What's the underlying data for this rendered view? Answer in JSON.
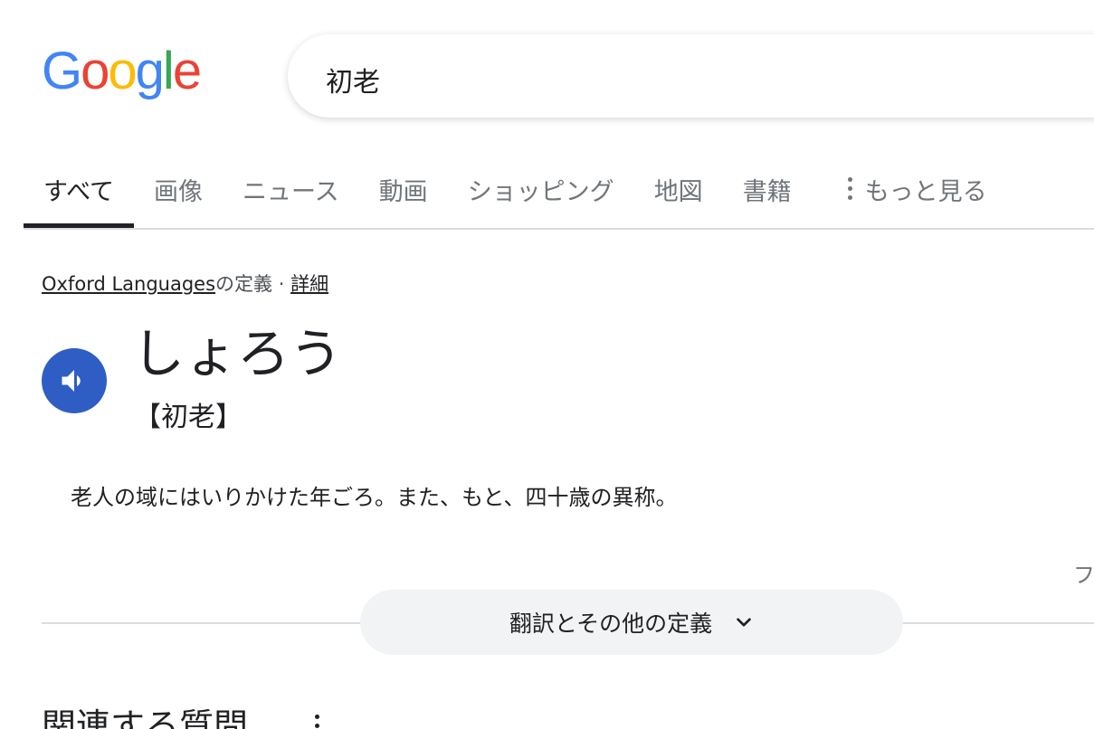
{
  "logo": {
    "letters": [
      {
        "char": "G",
        "color": "#4285F4"
      },
      {
        "char": "o",
        "color": "#EA4335"
      },
      {
        "char": "o",
        "color": "#FBBC05"
      },
      {
        "char": "g",
        "color": "#4285F4"
      },
      {
        "char": "l",
        "color": "#34A853"
      },
      {
        "char": "e",
        "color": "#EA4335"
      }
    ]
  },
  "search": {
    "query": "初老"
  },
  "tabs": [
    {
      "label": "すべて",
      "active": true
    },
    {
      "label": "画像"
    },
    {
      "label": "ニュース"
    },
    {
      "label": "動画"
    },
    {
      "label": "ショッピング"
    },
    {
      "label": "地図"
    },
    {
      "label": "書籍"
    }
  ],
  "more_tab": {
    "label": "もっと見る",
    "icon": "more-vert-icon"
  },
  "dictionary": {
    "source_link": "Oxford Languages",
    "source_suffix": "の定義 · ",
    "details_link": "詳細",
    "speaker_icon": "volume-icon",
    "accent_color": "#2e5dc4",
    "headword": "しょろう",
    "kanji": "【初老】",
    "definition": "老人の域にはいりかけた年ごろ。また、もと、四十歳の異称。",
    "edge_text": "フ"
  },
  "expand": {
    "label": "翻訳とその他の定義",
    "icon": "chevron-down-icon"
  },
  "related": {
    "title": "関連する質問",
    "icon": "more-vert-icon"
  }
}
